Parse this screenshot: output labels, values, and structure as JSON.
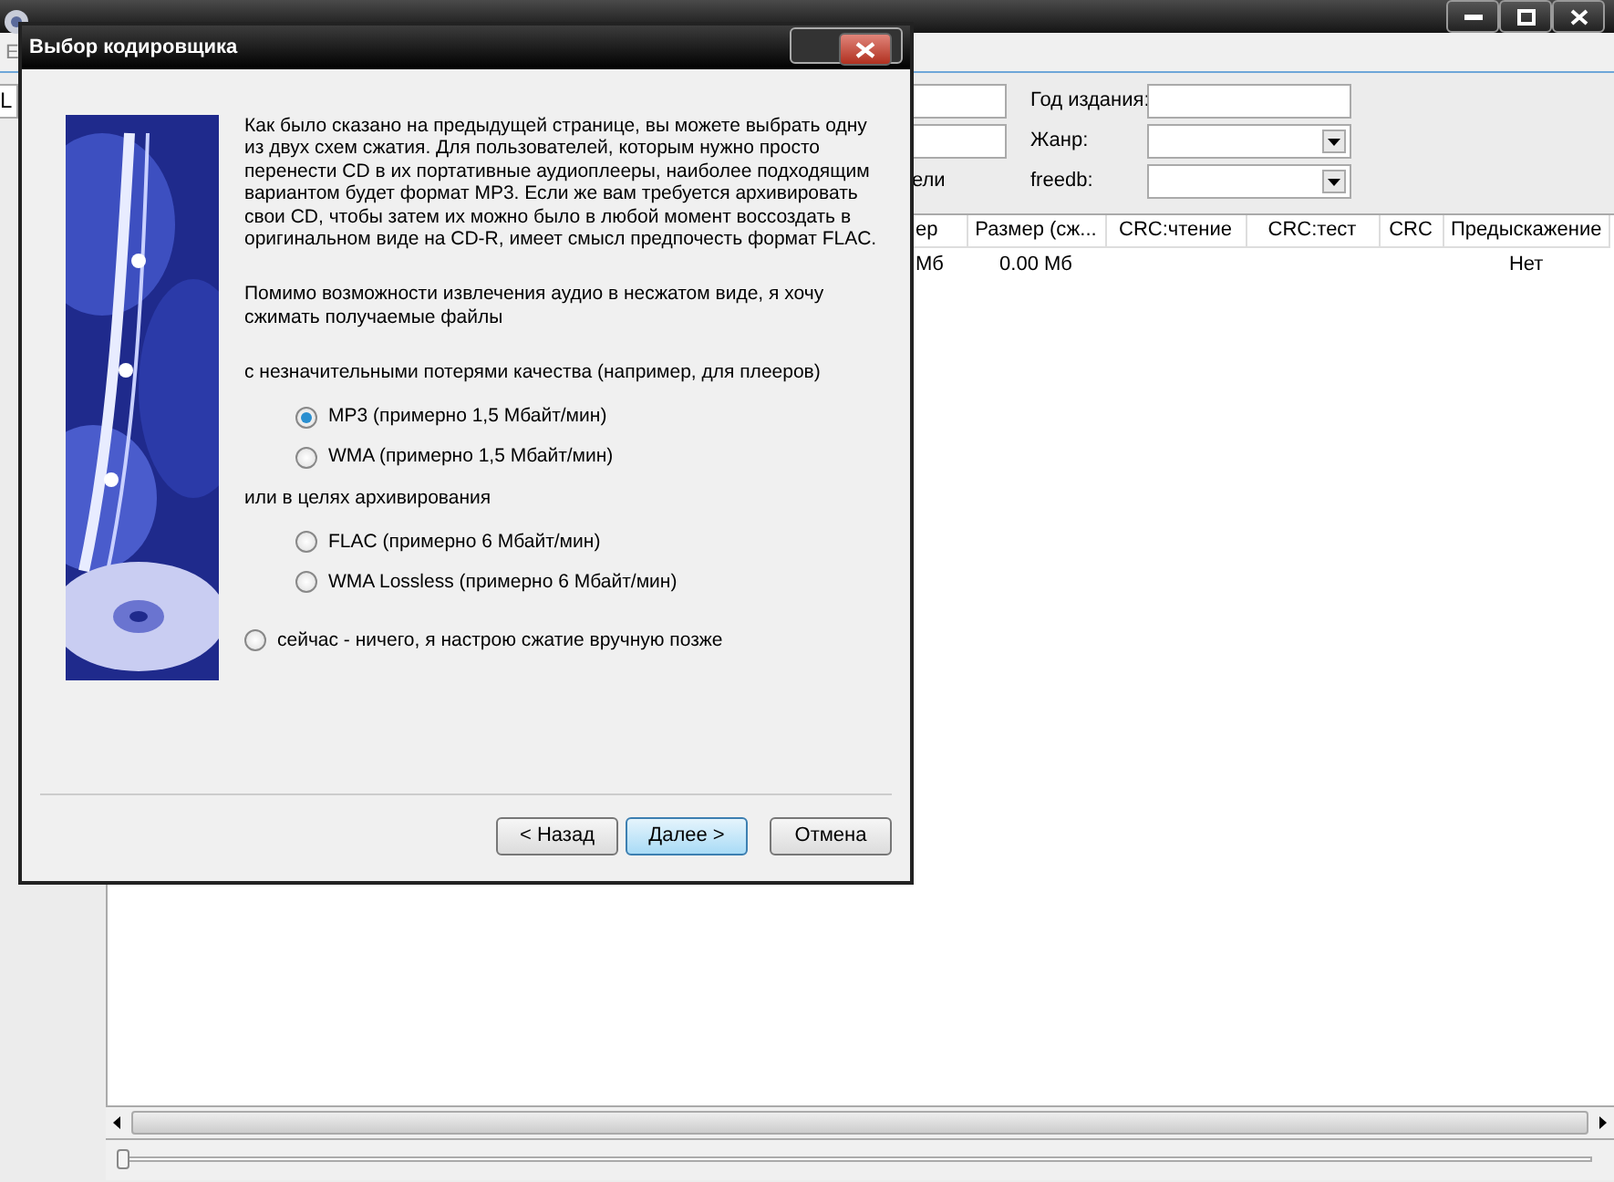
{
  "position_slider": {
    "level": 0
  },
  "menu_bar": [
    "E"
  ],
  "left_field": {
    "value": "L"
  },
  "form": {
    "rows": [
      {
        "left": {
          "kind": "input"
        },
        "label": "Год издания:",
        "field": {
          "kind": "input"
        }
      },
      {
        "left": {
          "kind": "input"
        },
        "label": "Жанр:",
        "field": {
          "kind": "select"
        }
      },
      {
        "left": {
          "kind": "text",
          "text": "ели"
        },
        "label": "freedb:",
        "field": {
          "kind": "select"
        }
      }
    ]
  },
  "table": {
    "columns": [
      "ер",
      "Размер (сж...",
      "CRC:чтение",
      "CRC:тест",
      "CRC",
      "Предыскажение"
    ],
    "rows": [
      [
        "Мб",
        "0.00 Мб",
        null,
        null,
        null,
        "Нет"
      ]
    ]
  },
  "dialog": {
    "title": "Выбор кодировщика",
    "paragraphs": [
      "Как было сказано на предыдущей странице, вы можете выбрать одну из двух схем сжатия. Для пользователей, которым нужно просто перенести CD в их портативные аудиоплееры, наиболее подходящим вариантом будет формат MP3. Если же вам требуется архивировать свои CD, чтобы затем их можно было в любой момент воссоздать в оригинальном виде на CD-R, имеет смысл предпочесть формат FLAC.",
      "Помимо возможности извлечения аудио в несжатом виде, я хочу сжимать получаемые файлы"
    ],
    "groups": [
      {
        "heading": "с незначительными потерями качества (например, для плееров)",
        "options": [
          {
            "label": "MP3 (примерно 1,5 Мбайт/мин)",
            "selected": true
          },
          {
            "label": "WMA (примерно 1,5 Мбайт/мин)",
            "selected": false
          }
        ]
      },
      {
        "heading": "или в целях архивирования",
        "options": [
          {
            "label": "FLAC (примерно 6 Мбайт/мин)",
            "selected": false
          },
          {
            "label": "WMA Lossless (примерно 6 Мбайт/мин)",
            "selected": false
          }
        ]
      }
    ],
    "other_option": {
      "label": "сейчас - ничего, я настрою сжатие вручную позже",
      "selected": false
    },
    "buttons": [
      {
        "label": "< Назад",
        "default": false
      },
      {
        "label": "Далее >",
        "default": true
      },
      {
        "label": "Отмена",
        "default": false
      }
    ]
  }
}
